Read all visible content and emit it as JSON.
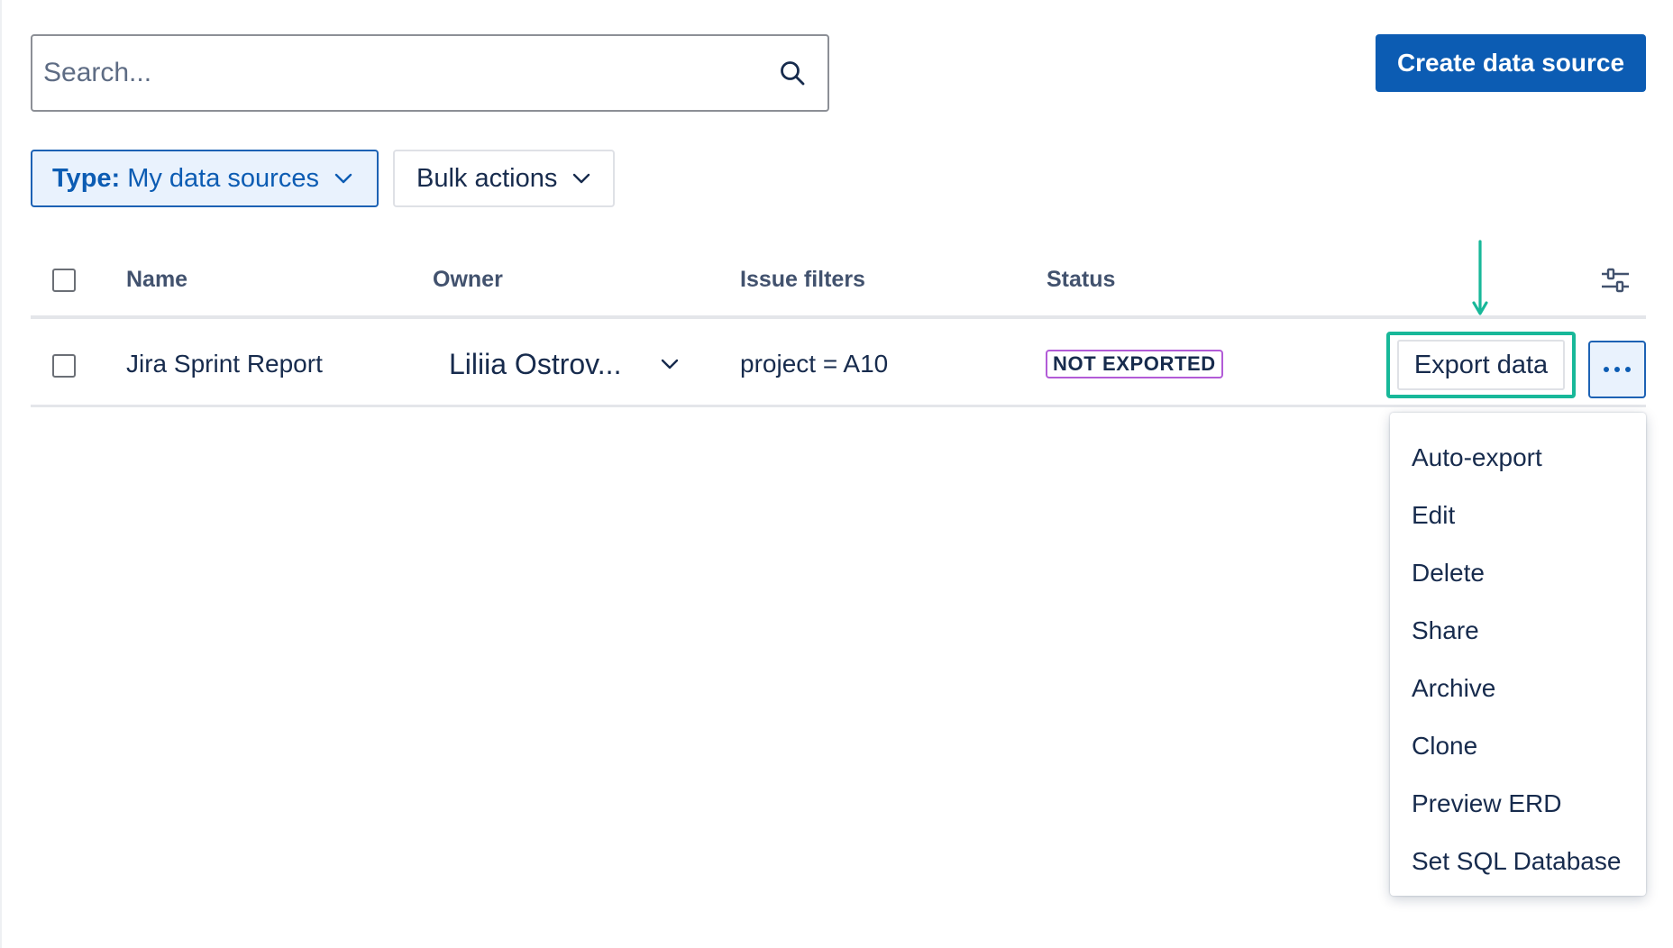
{
  "search": {
    "placeholder": "Search..."
  },
  "header": {
    "create_label": "Create data source"
  },
  "filters": {
    "type_key": "Type:",
    "type_value": "My data sources",
    "bulk_label": "Bulk actions"
  },
  "table": {
    "columns": [
      "Name",
      "Owner",
      "Issue filters",
      "Status"
    ],
    "rows": [
      {
        "name": "Jira Sprint Report",
        "owner": "Liliia Ostrov...",
        "issue_filter": "project = A10",
        "status": "NOT EXPORTED",
        "action_label": "Export data"
      }
    ]
  },
  "menu": {
    "items": [
      "Auto-export",
      "Edit",
      "Delete",
      "Share",
      "Archive",
      "Clone",
      "Preview ERD",
      "Set SQL Database"
    ]
  },
  "colors": {
    "primary": "#0c5cb3",
    "highlight_annotation": "#18b899",
    "status_border": "#b25bd7",
    "selected_bg": "#e9f2fd"
  },
  "icons": {
    "search": "search-icon",
    "chevron": "chevron-down-icon",
    "settings": "sliders-icon",
    "more": "more-horizontal-icon",
    "annotation": "arrow-down-icon"
  }
}
